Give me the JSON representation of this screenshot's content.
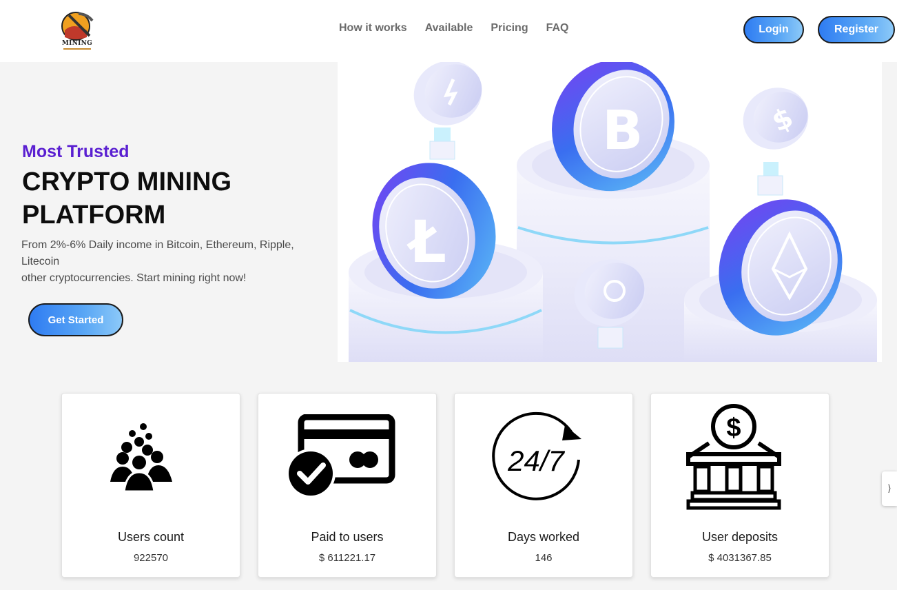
{
  "brand": {
    "logo_text": "MINING"
  },
  "nav": {
    "items": [
      "How it works",
      "Available",
      "Pricing",
      "FAQ"
    ]
  },
  "header": {
    "login_label": "Login",
    "register_label": "Register"
  },
  "hero": {
    "kicker": "Most Trusted",
    "title": "CRYPTO MINING PLATFORM",
    "description_line1": "From 2%-6% Daily income in Bitcoin, Ethereum, Ripple, Litecoin",
    "description_line2": "other cryptocurrencies. Start mining right now!",
    "cta_label": "Get Started"
  },
  "stats": [
    {
      "label": "Users count",
      "value": "922570",
      "icon": "users-group-icon"
    },
    {
      "label": "Paid to users",
      "value": "$ 611221.17",
      "icon": "card-check-icon"
    },
    {
      "label": "Days worked",
      "value": "146",
      "icon": "clock-24-7-icon",
      "icon_text": "24/7"
    },
    {
      "label": "User deposits",
      "value": "$ 4031367.85",
      "icon": "bank-dollar-icon"
    }
  ],
  "colors": {
    "accent_purple": "#5a1fd1",
    "button_blue": "#2f7cf2",
    "button_light": "#8cc9f8"
  }
}
